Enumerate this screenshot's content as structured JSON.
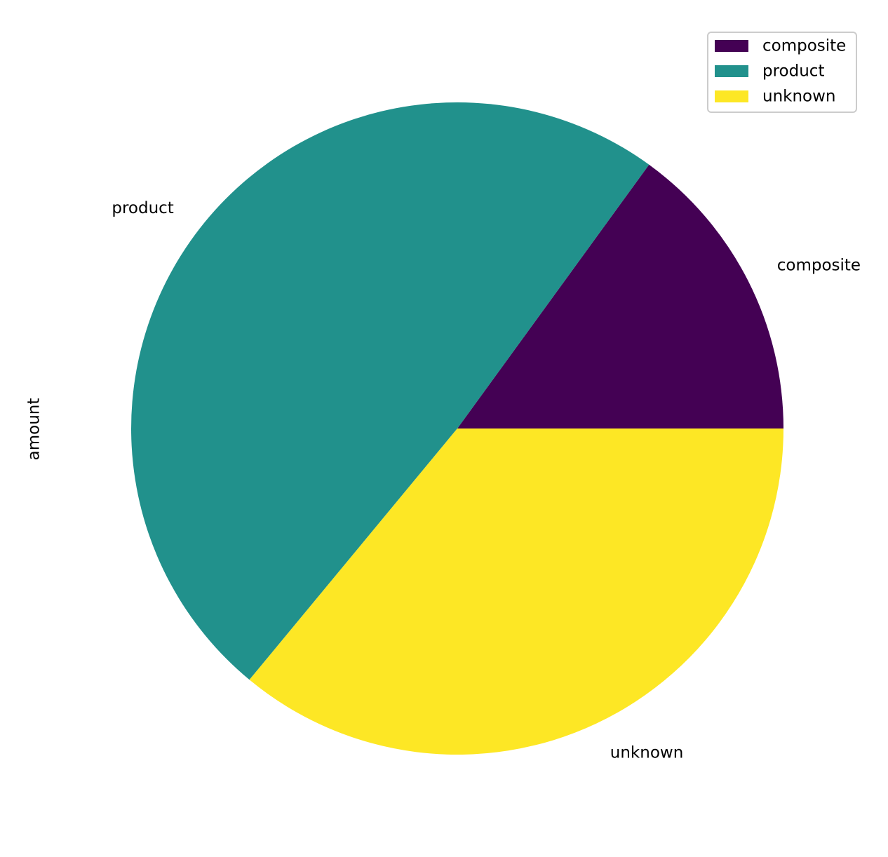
{
  "chart_data": {
    "type": "pie",
    "title": "",
    "ylabel": "amount",
    "categories": [
      "composite",
      "product",
      "unknown"
    ],
    "values": [
      15,
      49,
      36
    ],
    "colors": [
      "#440154",
      "#21918c",
      "#fde725"
    ],
    "start_angle": 0,
    "direction": "counterclockwise",
    "legend": {
      "placement": "top-right",
      "entries": [
        "composite",
        "product",
        "unknown"
      ]
    }
  }
}
